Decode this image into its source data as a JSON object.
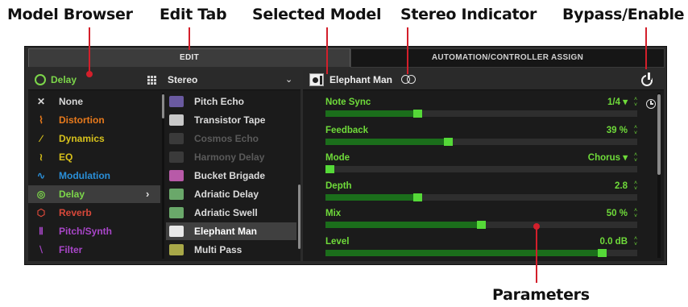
{
  "callouts": {
    "model_browser": "Model Browser",
    "edit_tab": "Edit Tab",
    "selected_model": "Selected Model",
    "stereo_indicator": "Stereo Indicator",
    "bypass_enable": "Bypass/Enable",
    "parameters": "Parameters"
  },
  "tabs": {
    "edit": "EDIT",
    "automation": "AUTOMATION/CONTROLLER ASSIGN"
  },
  "browser": {
    "category_header": "Delay",
    "channel": "Stereo",
    "categories": [
      {
        "label": "None",
        "icon": "x-icon",
        "color": "#d8d8d8"
      },
      {
        "label": "Distortion",
        "icon": "distortion-icon",
        "color": "#e87a1c"
      },
      {
        "label": "Dynamics",
        "icon": "dynamics-icon",
        "color": "#d7c21c"
      },
      {
        "label": "EQ",
        "icon": "eq-icon",
        "color": "#d8c01a"
      },
      {
        "label": "Modulation",
        "icon": "modulation-icon",
        "color": "#2a8fd8"
      },
      {
        "label": "Delay",
        "icon": "delay-icon",
        "color": "#7cd64a",
        "selected": true
      },
      {
        "label": "Reverb",
        "icon": "reverb-icon",
        "color": "#d8483a"
      },
      {
        "label": "Pitch/Synth",
        "icon": "pitch-synth-icon",
        "color": "#a846c8"
      },
      {
        "label": "Filter",
        "icon": "filter-icon",
        "color": "#a846c8"
      }
    ],
    "models": [
      {
        "label": "Pitch Echo",
        "thumb": "#6a5aa0"
      },
      {
        "label": "Transistor Tape",
        "thumb": "#c8c8c8"
      },
      {
        "label": "Cosmos Echo",
        "thumb": "#3a3a3a",
        "dim": true
      },
      {
        "label": "Harmony Delay",
        "thumb": "#3a3a3a",
        "dim": true
      },
      {
        "label": "Bucket Brigade",
        "thumb": "#b85aa8"
      },
      {
        "label": "Adriatic Delay",
        "thumb": "#6aa86a"
      },
      {
        "label": "Adriatic Swell",
        "thumb": "#6aa86a"
      },
      {
        "label": "Elephant Man",
        "thumb": "#e8e8e8",
        "selected": true
      },
      {
        "label": "Multi Pass",
        "thumb": "#a8a848"
      }
    ]
  },
  "model": {
    "name": "Elephant Man"
  },
  "parameters": [
    {
      "label": "Note Sync",
      "value": "1/4 ▾",
      "level": 0.29
    },
    {
      "label": "Feedback",
      "value": "39 %",
      "level": 0.39
    },
    {
      "label": "Mode",
      "value": "Chorus ▾",
      "level": 0.0
    },
    {
      "label": "Depth",
      "value": "2.8",
      "level": 0.29
    },
    {
      "label": "Mix",
      "value": "50 %",
      "level": 0.5
    },
    {
      "label": "Level",
      "value": "0.0 dB",
      "level": 0.9
    }
  ]
}
